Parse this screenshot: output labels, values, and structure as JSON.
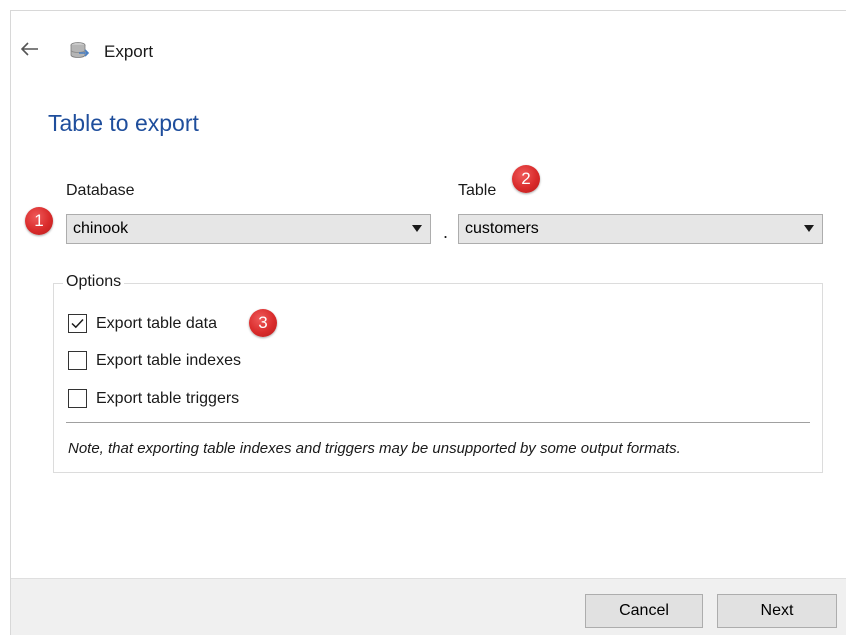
{
  "header": {
    "title": "Export",
    "back_icon": "arrow-left-icon",
    "app_icon": "database-export-icon"
  },
  "section": {
    "heading": "Table to export"
  },
  "database": {
    "label": "Database",
    "value": "chinook"
  },
  "separator": ".",
  "table": {
    "label": "Table",
    "value": "customers"
  },
  "options": {
    "legend": "Options",
    "items": [
      {
        "label": "Export table data",
        "checked": true
      },
      {
        "label": "Export table indexes",
        "checked": false
      },
      {
        "label": "Export table triggers",
        "checked": false
      }
    ],
    "note": "Note, that exporting table indexes and triggers may be unsupported by some output formats."
  },
  "badges": [
    "1",
    "2",
    "3"
  ],
  "footer": {
    "cancel_label": "Cancel",
    "next_label": "Next"
  },
  "colors": {
    "heading": "#1f4e9c",
    "badge": "#d92b2b",
    "combo_bg": "#e6e6e6",
    "footer_bg": "#f0f0f0"
  }
}
